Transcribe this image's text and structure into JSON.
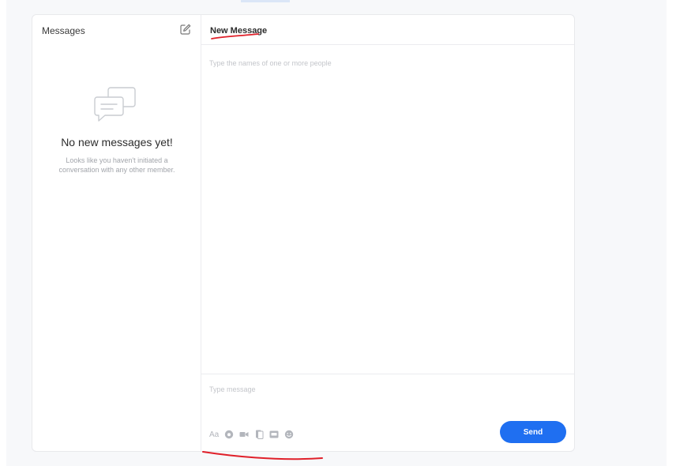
{
  "sidebar": {
    "title": "Messages",
    "compose_icon": "compose-edit-icon",
    "empty_state": {
      "icon": "chat-bubbles-icon",
      "title": "No new messages yet!",
      "description": "Looks like you haven't initiated a conversation with any other member."
    }
  },
  "main": {
    "title": "New Message",
    "recipients_placeholder": "Type the names of one or more people"
  },
  "composer": {
    "message_placeholder": "Type message",
    "toolbar": {
      "text_format_label": "Aa",
      "icons": [
        "camera-icon",
        "video-icon",
        "document-icon",
        "gif-icon",
        "emoji-icon"
      ]
    },
    "send_label": "Send"
  },
  "colors": {
    "accent": "#1f6ff1",
    "annotation": "#e0202a",
    "muted_text": "#a2a5ab"
  }
}
